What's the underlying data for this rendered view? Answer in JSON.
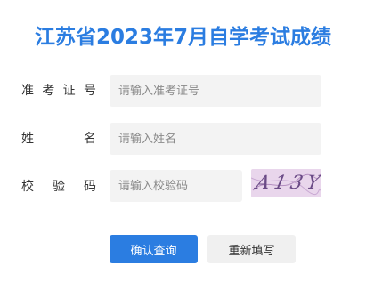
{
  "title": "江苏省2023年7月自学考试成绩",
  "form": {
    "ticket_label": [
      "准",
      "考",
      "证",
      "号"
    ],
    "name_label": [
      "姓",
      "名"
    ],
    "code_label": [
      "校",
      "验",
      "码"
    ],
    "ticket_placeholder": "请输入准考证号",
    "name_placeholder": "请输入姓名",
    "code_placeholder": "请输入校验码",
    "captcha_text": "A13Y"
  },
  "buttons": {
    "submit_label": "确认查询",
    "reset_label": "重新填写"
  },
  "colors": {
    "accent": "#2b7de1",
    "input_bg": "#f3f3f3",
    "captcha_bg": "#e9d6ec"
  }
}
